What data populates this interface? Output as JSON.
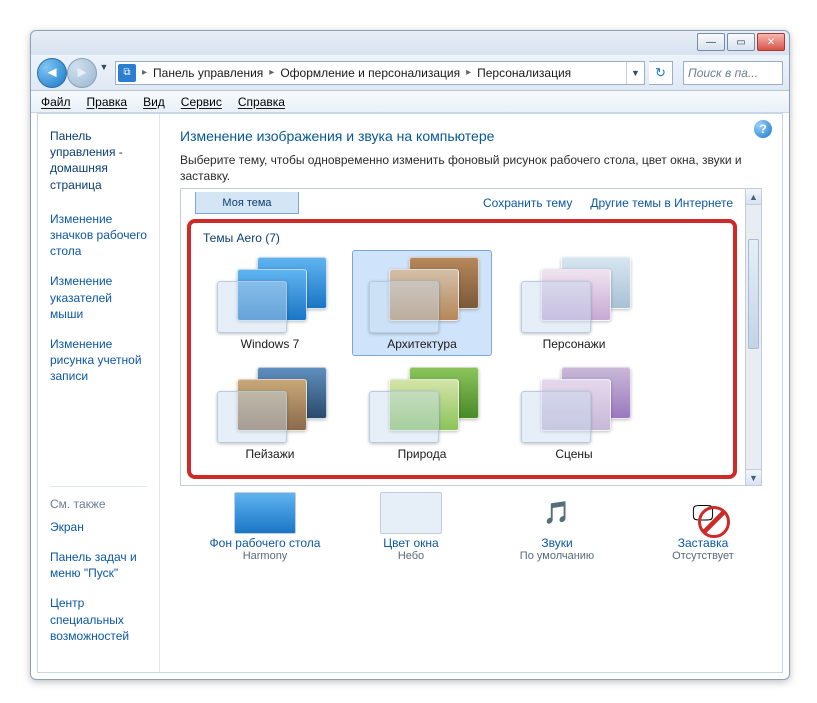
{
  "window": {
    "min": "—",
    "max": "▭",
    "close": "✕"
  },
  "breadcrumb": {
    "root": "Панель управления",
    "mid": "Оформление и персонализация",
    "leaf": "Персонализация"
  },
  "search": {
    "placeholder": "Поиск в па..."
  },
  "menu": {
    "file": "Файл",
    "edit": "Правка",
    "view": "Вид",
    "tools": "Сервис",
    "help": "Справка"
  },
  "sidebar": {
    "home": "Панель управления - домашняя страница",
    "links": [
      "Изменение значков рабочего стола",
      "Изменение указателей мыши",
      "Изменение рисунка учетной записи"
    ],
    "see_also_title": "См. также",
    "see_also": [
      "Экран",
      "Панель задач и меню \"Пуск\"",
      "Центр специальных возможностей"
    ]
  },
  "main": {
    "title": "Изменение изображения и звука на компьютере",
    "desc": "Выберите тему, чтобы одновременно изменить фоновый рисунок рабочего стола, цвет окна, звуки и заставку.",
    "my_theme_tab": "Моя тема",
    "save_theme": "Сохранить тему",
    "more_themes": "Другие темы в Интернете",
    "aero_title": "Темы Aero (7)",
    "aero_themes": [
      {
        "label": "Windows 7",
        "cls": "tWin7"
      },
      {
        "label": "Архитектура",
        "cls": "tArch",
        "selected": true
      },
      {
        "label": "Персонажи",
        "cls": "tChar"
      },
      {
        "label": "Пейзажи",
        "cls": "tLand"
      },
      {
        "label": "Природа",
        "cls": "tNat"
      },
      {
        "label": "Сцены",
        "cls": "tScen"
      }
    ],
    "bottom": {
      "bg": {
        "title": "Фон рабочего стола",
        "value": "Harmony"
      },
      "color": {
        "title": "Цвет окна",
        "value": "Небо"
      },
      "sounds": {
        "title": "Звуки",
        "value": "По умолчанию"
      },
      "saver": {
        "title": "Заставка",
        "value": "Отсутствует"
      }
    }
  }
}
